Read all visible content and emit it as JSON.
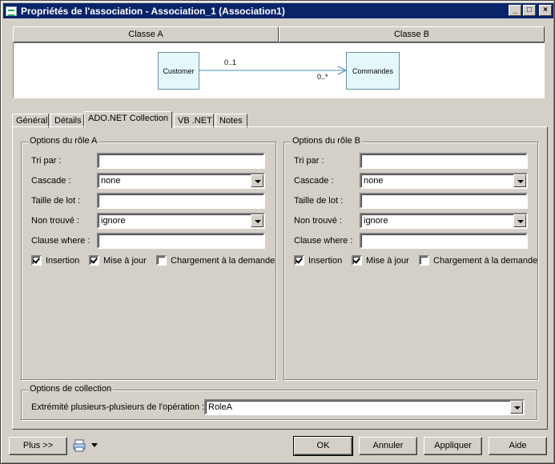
{
  "window": {
    "title": "Propriétés de l'association - Association_1 (Association1)",
    "minimize": "_",
    "maximize": "□",
    "close": "×"
  },
  "classes": {
    "class_a": "Classe A",
    "class_b": "Classe B"
  },
  "diagram": {
    "source": "Customer",
    "target": "Commandes",
    "source_multiplicity": "0..1",
    "target_multiplicity": "0..*"
  },
  "tabs": [
    {
      "label": "Général"
    },
    {
      "label": "Détails"
    },
    {
      "label": "ADO.NET Collection"
    },
    {
      "label": "VB .NET"
    },
    {
      "label": "Notes"
    }
  ],
  "active_tab": "ADO.NET Collection",
  "role_a": {
    "legend": "Options du rôle A",
    "tri_par": {
      "label": "Tri par :",
      "value": ""
    },
    "cascade": {
      "label": "Cascade :",
      "value": "none"
    },
    "taille_lot": {
      "label": "Taille de lot :",
      "value": ""
    },
    "non_trouve": {
      "label": "Non trouvé :",
      "value": "ignore"
    },
    "clause_where": {
      "label": "Clause where :",
      "value": ""
    },
    "insertion": {
      "label": "Insertion",
      "checked": true
    },
    "mise_a_jour": {
      "label": "Mise à jour",
      "checked": true
    },
    "chargement": {
      "label": "Chargement à la demande",
      "checked": false
    }
  },
  "role_b": {
    "legend": "Options du rôle B",
    "tri_par": {
      "label": "Tri par :",
      "value": ""
    },
    "cascade": {
      "label": "Cascade :",
      "value": "none"
    },
    "taille_lot": {
      "label": "Taille de lot :",
      "value": ""
    },
    "non_trouve": {
      "label": "Non trouvé :",
      "value": "ignore"
    },
    "clause_where": {
      "label": "Clause where :",
      "value": ""
    },
    "insertion": {
      "label": "Insertion",
      "checked": true
    },
    "mise_a_jour": {
      "label": "Mise à jour",
      "checked": true
    },
    "chargement": {
      "label": "Chargement à la demande",
      "checked": false
    }
  },
  "collection": {
    "legend": "Options de collection",
    "label": "Extrémité plusieurs-plusieurs de l'opération :",
    "value": "RoleA"
  },
  "buttons": {
    "plus": "Plus >>",
    "ok": "OK",
    "annuler": "Annuler",
    "appliquer": "Appliquer",
    "aide": "Aide"
  }
}
